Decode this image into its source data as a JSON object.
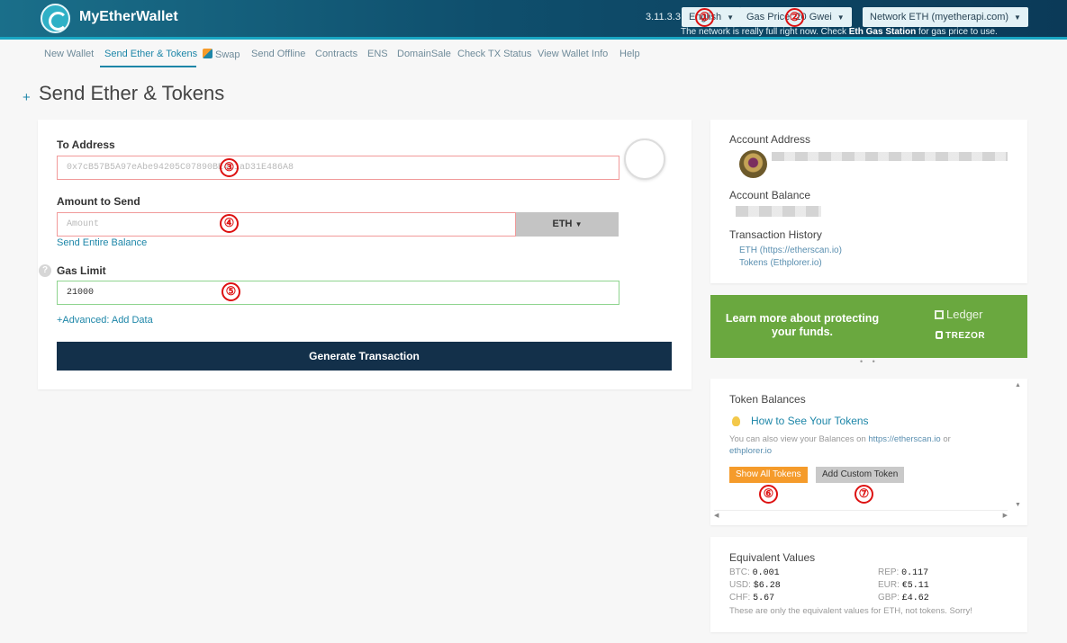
{
  "header": {
    "brand": "MyEtherWallet",
    "version": "3.11.3.3",
    "language": "English",
    "gas_price": "Gas Price: 20 Gwei",
    "network": "Network ETH (myetherapi.com)",
    "network_msg_pre": "The network is really full right now. Check",
    "network_msg_link": "Eth Gas Station",
    "network_msg_post": "for gas price to use."
  },
  "nav": {
    "items": [
      "New Wallet",
      "Send Ether & Tokens",
      "Swap",
      "Send Offline",
      "Contracts",
      "ENS",
      "DomainSale",
      "Check TX Status",
      "View Wallet Info",
      "Help"
    ],
    "active": "Send Ether & Tokens"
  },
  "page": {
    "plus": "+",
    "title": "Send Ether & Tokens"
  },
  "form": {
    "to_label": "To Address",
    "to_placeholder": "0x7cB57B5A97eAbe94205C07890BE4c1aD31E486A8",
    "amount_label": "Amount to Send",
    "amount_placeholder": "Amount",
    "unit": "ETH",
    "send_entire": "Send Entire Balance",
    "gas_label": "Gas Limit",
    "gas_value": "21000",
    "advanced": "+Advanced: Add Data",
    "generate": "Generate Transaction",
    "help": "?"
  },
  "account": {
    "address_label": "Account Address",
    "balance_label": "Account Balance",
    "history_label": "Transaction History",
    "history_links": [
      "ETH (https://etherscan.io)",
      "Tokens (Ethplorer.io)"
    ]
  },
  "promo": {
    "text": "Learn more about protecting your funds.",
    "ledger": "Ledger",
    "trezor": "TREZOR",
    "dots": "• •"
  },
  "tokens": {
    "title": "Token Balances",
    "how_to": "How to See Your Tokens",
    "note_pre": "You can also view your Balances on",
    "note_link1": "https://etherscan.io",
    "note_or": "or",
    "note_link2": "ethplorer.io",
    "show_all": "Show All Tokens",
    "add_custom": "Add Custom Token",
    "scroll_up": "▲",
    "scroll_down": "▼",
    "scroll_left": "◀",
    "scroll_right": "▶"
  },
  "equivalent": {
    "title": "Equivalent Values",
    "rows": [
      {
        "k": "BTC:",
        "v": "0.001"
      },
      {
        "k": "REP:",
        "v": "0.117"
      },
      {
        "k": "USD:",
        "v": "$6.28"
      },
      {
        "k": "EUR:",
        "v": "€5.11"
      },
      {
        "k": "CHF:",
        "v": "5.67"
      },
      {
        "k": "GBP:",
        "v": "£4.62"
      }
    ],
    "note": "These are only the equivalent values for ETH, not tokens. Sorry!"
  },
  "markers": [
    "①",
    "②",
    "③",
    "④",
    "⑤",
    "⑥",
    "⑦"
  ],
  "colors": {
    "header": "#0f4f6d",
    "accent": "#18a6c3",
    "primary_button": "#13304a",
    "promo": "#6aa83f",
    "orange": "#f59b2b"
  },
  "icons": [
    "logo-icon",
    "swap-icon",
    "help-icon",
    "identicon",
    "avatar",
    "ledger-icon",
    "lock-icon",
    "bulb-icon",
    "caret-down-icon"
  ]
}
